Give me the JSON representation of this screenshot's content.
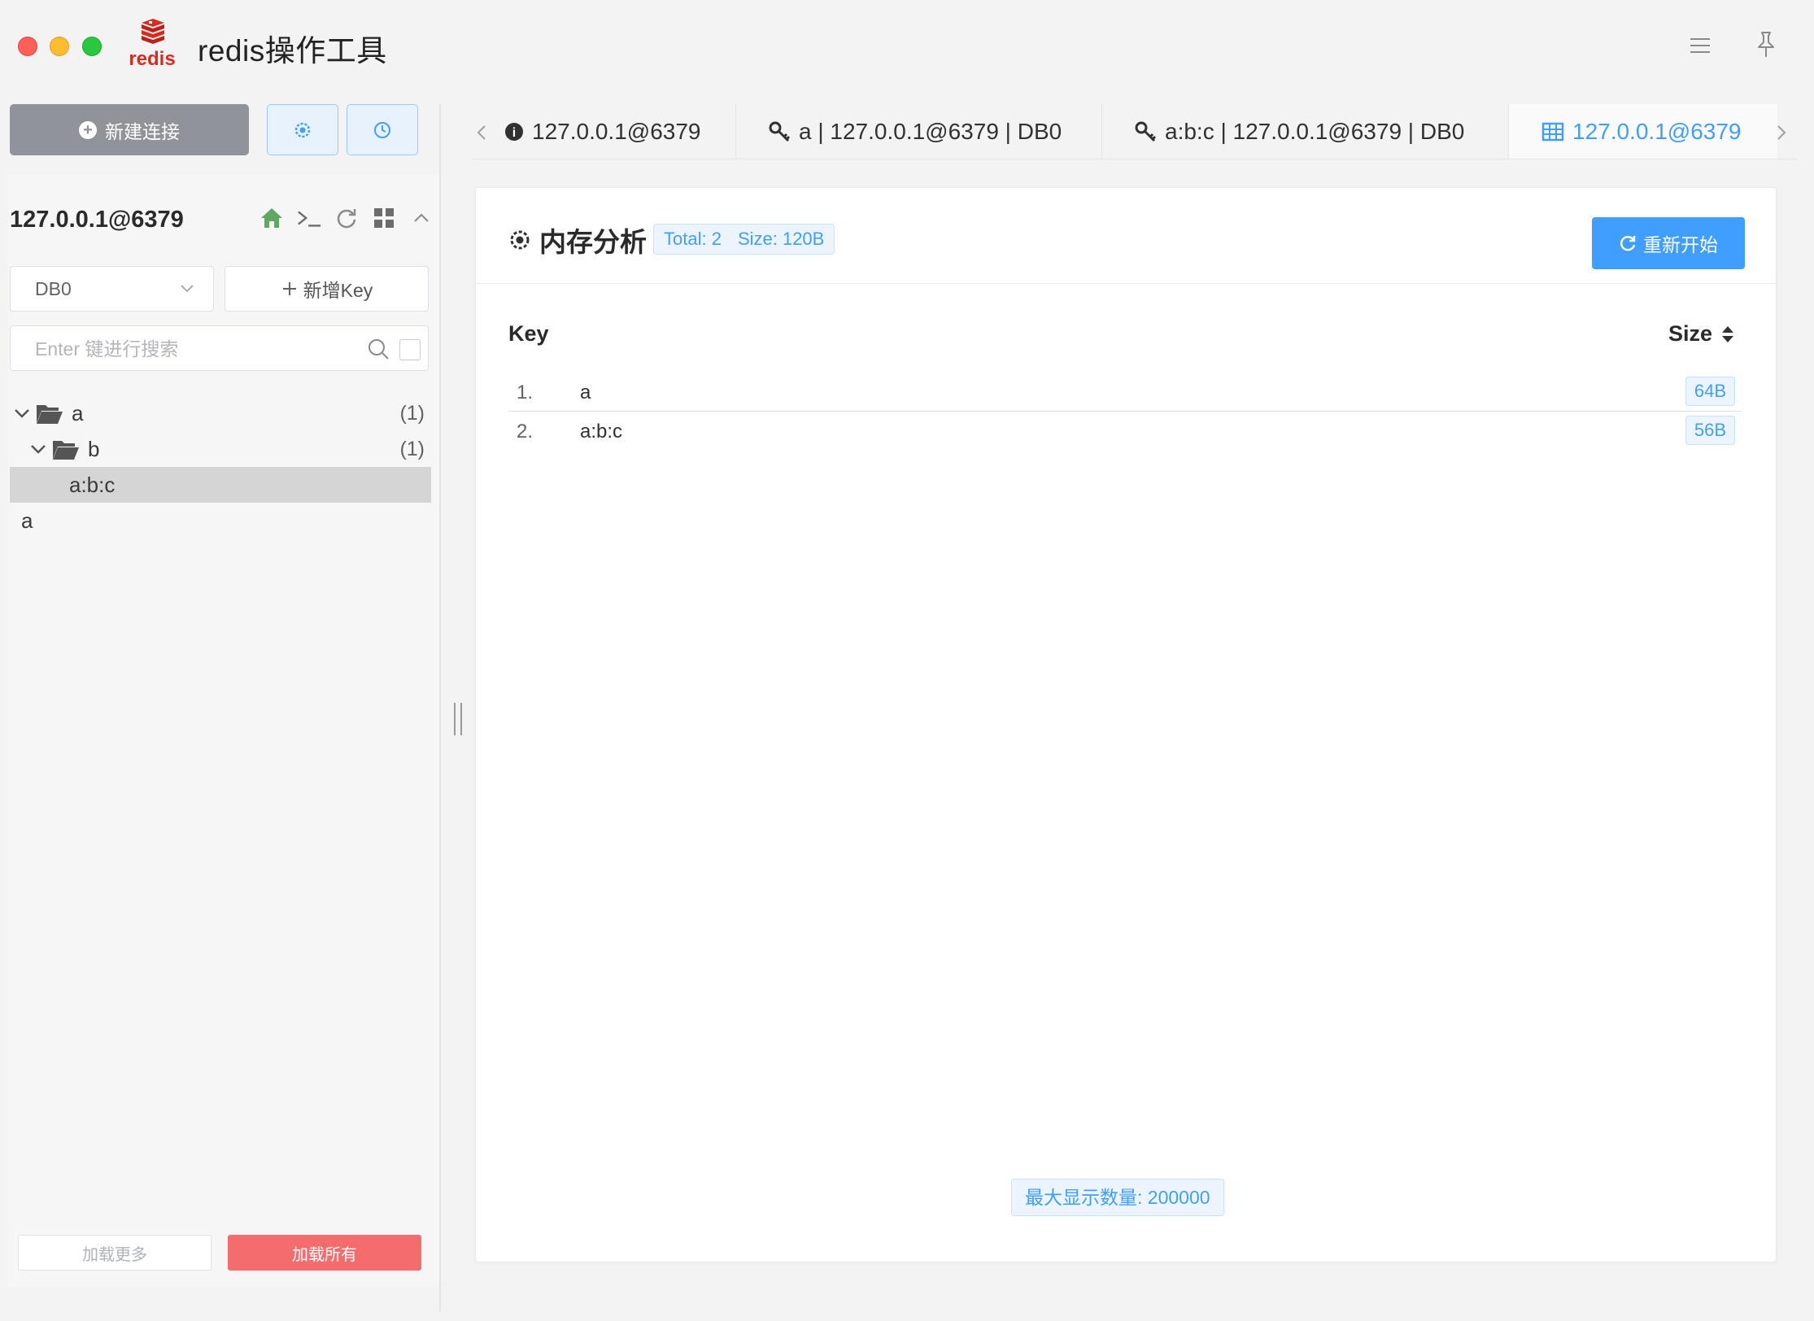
{
  "window": {
    "title": "redis操作工具",
    "logo_text": "redis"
  },
  "sidebar": {
    "new_connection_label": "新建连接",
    "connection_name": "127.0.0.1@6379",
    "db_select_value": "DB0",
    "add_key_label": "新增Key",
    "search_placeholder": "Enter 键进行搜索",
    "tree": [
      {
        "label": "a",
        "count": "(1)",
        "type": "folder",
        "level": 0
      },
      {
        "label": "b",
        "count": "(1)",
        "type": "folder",
        "level": 1
      },
      {
        "label": "a:b:c",
        "count": "",
        "type": "key",
        "level": 2,
        "selected": true
      },
      {
        "label": "a",
        "count": "",
        "type": "key",
        "level": 0
      }
    ],
    "load_more_label": "加载更多",
    "load_all_label": "加载所有"
  },
  "tabs": [
    {
      "label": "127.0.0.1@6379",
      "icon": "info-icon"
    },
    {
      "label": "a | 127.0.0.1@6379 | DB0",
      "icon": "key-icon"
    },
    {
      "label": "a:b:c | 127.0.0.1@6379 | DB0",
      "icon": "key-icon"
    },
    {
      "label": "127.0.0.1@6379",
      "icon": "table-icon",
      "active": true
    }
  ],
  "analysis": {
    "title": "内存分析",
    "total_label": "Total: 2",
    "size_label": "Size: 120B",
    "restart_label": "重新开始",
    "columns": {
      "key": "Key",
      "size": "Size"
    },
    "rows": [
      {
        "index": "1.",
        "key": "a",
        "size": "64B"
      },
      {
        "index": "2.",
        "key": "a:b:c",
        "size": "56B"
      }
    ],
    "max_display_label": "最大显示数量: 200000"
  },
  "colors": {
    "primary": "#409eff",
    "danger": "#f56c6c",
    "neutral_button": "#909399",
    "selected_row": "#d5d5d5",
    "redis_red": "#d82c20"
  }
}
